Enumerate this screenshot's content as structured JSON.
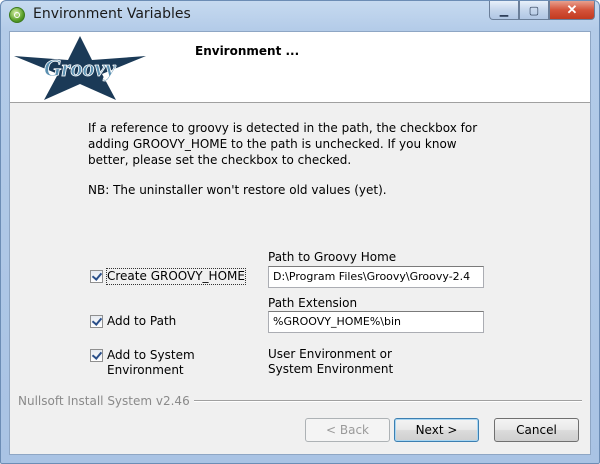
{
  "window": {
    "title": "Environment Variables",
    "controls": {
      "minimize": "▁",
      "maximize": "▢",
      "close": "✕"
    }
  },
  "header": {
    "title": "Environment ...",
    "logo_text": "Groovy"
  },
  "content": {
    "description": "If a reference to groovy is detected in the path, the checkbox for adding GROOVY_HOME to the path is unchecked. If you know better, please set the checkbox to checked.",
    "note": "NB: The uninstaller won't restore old values (yet)."
  },
  "options": {
    "create_home": {
      "label": "Create GROOVY_HOME",
      "checked": true
    },
    "add_to_path": {
      "label": "Add to Path",
      "checked": true
    },
    "add_to_system": {
      "label_line1": "Add to System",
      "label_line2": "Environment",
      "checked": true
    }
  },
  "fields": {
    "groovy_home": {
      "label": "Path to Groovy Home",
      "value": "D:\\Program Files\\Groovy\\Groovy-2.4"
    },
    "path_extension": {
      "label": "Path Extension",
      "value": "%GROOVY_HOME%\\bin"
    },
    "environment_type": {
      "line1": "User Environment or",
      "line2": "System Environment"
    }
  },
  "footer": {
    "brand": "Nullsoft Install System v2.46",
    "back_label": "< Back",
    "next_label": "Next >",
    "cancel_label": "Cancel"
  },
  "colors": {
    "logo_star": "#1b3a57",
    "logo_text": "#5a8fb0"
  }
}
